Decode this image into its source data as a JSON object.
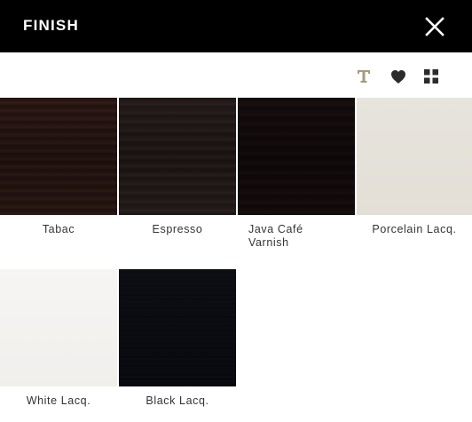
{
  "header": {
    "title": "FINISH",
    "close_icon": "close-icon"
  },
  "toolbar": {
    "text_view_icon": "text-icon",
    "favorites_icon": "heart-icon",
    "grid_view_icon": "grid-icon",
    "accent_color": "#a89a7c"
  },
  "finishes": [
    {
      "label": "Tabac",
      "color": "#221310"
    },
    {
      "label": "Espresso",
      "color": "#1f1715"
    },
    {
      "label": "Java Café\nVarnish",
      "color": "#120a0a"
    },
    {
      "label": "Porcelain Lacq.",
      "color": "#e5e2da"
    },
    {
      "label": "White Lacq.",
      "color": "#f4f3f1"
    },
    {
      "label": "Black Lacq.",
      "color": "#090a10"
    }
  ]
}
